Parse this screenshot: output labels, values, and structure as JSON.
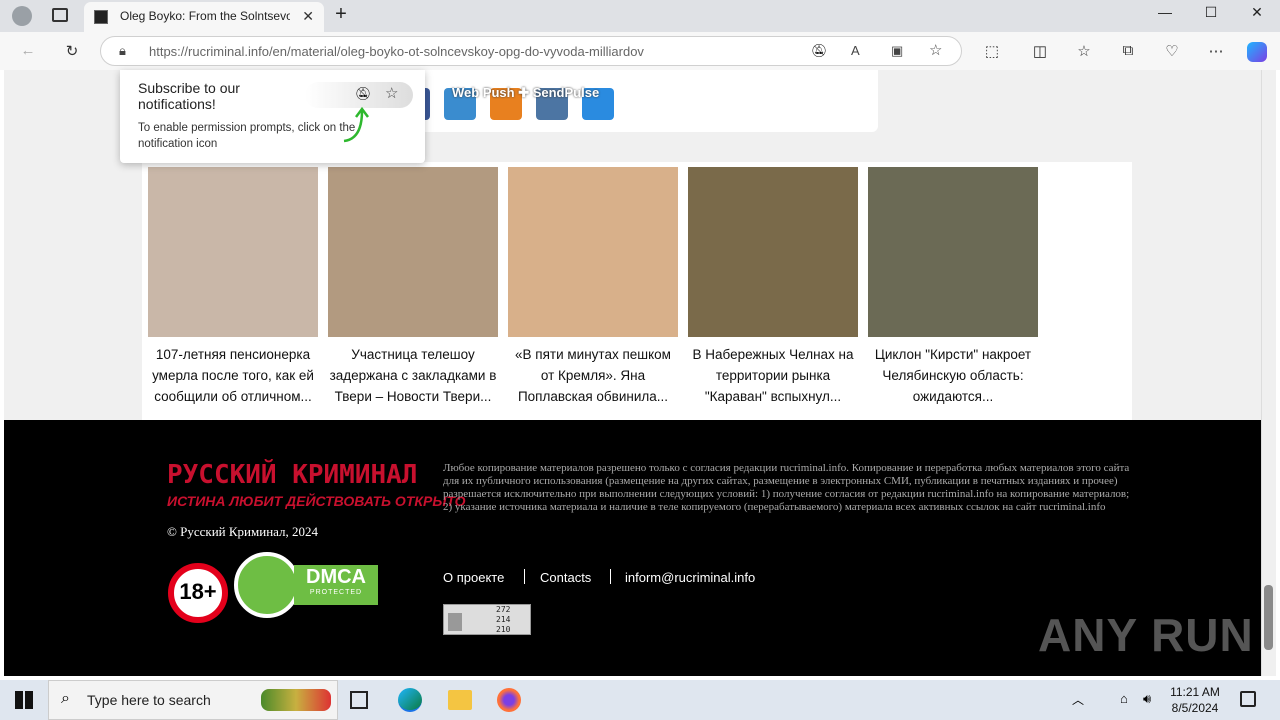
{
  "browser": {
    "tab_title": "Oleg Boyko: From the Solntsevo",
    "url_domain": "https://rucriminal.info",
    "url_path": "/en/material/oleg-boyko-ot-solncevskoy-opg-do-vyvoda-milliardov",
    "controls": {
      "min": "—",
      "max": "☐",
      "close": "✕",
      "new_tab": "+"
    }
  },
  "notification": {
    "heading": "Subscribe to our notifications!",
    "body": "To enable permission prompts, click on the notification icon"
  },
  "webpush": "Web Push ✚ SendPulse",
  "related": [
    {
      "caption": "107-летняя пенсионерка умерла после того, как ей сообщили об отличном...",
      "color": "#c9b7a8"
    },
    {
      "caption": "Участница телешоу задержана с закладками в Твери – Новости Твери...",
      "color": "#b29a80"
    },
    {
      "caption": "«В пяти минутах пешком от Кремля». Яна Поплавская обвинила...",
      "color": "#d8b08a"
    },
    {
      "caption": "В Набережных Челнах на территории рынка \"Караван\" вспыхнул...",
      "color": "#7a6a4a"
    },
    {
      "caption": "Циклон \"Кирсти\" накроет Челябинскую область: ожидаются...",
      "color": "#6b6a55"
    }
  ],
  "footer": {
    "logo_title": "РУССКИЙ КРИМИНАЛ",
    "logo_tagline": "ИСТИНА ЛЮБИТ ДЕЙСТВОВАТЬ ОТКРЫТО",
    "copyright": "© Русский Криминал, 2024",
    "legal": "Любое копирование материалов разрешено только с согласия редакции rucriminal.info. Копирование и переработка любых материалов этого сайта для их публичного использования (размещение на других сайтах, размещение в электронных СМИ, публикации в печатных изданиях и прочее) разрешается исключительно при выполнении следующих условий: 1) получение согласия от редакции rucriminal.info на копирование материалов; 2) указание источника материала и наличие в теле копируемого (перерабатываемого) материала всех активных ссылок на сайт rucriminal.info",
    "links": [
      "О проекте",
      "Contacts",
      "inform@rucriminal.info"
    ],
    "age": "18+",
    "dmca": "DMCA",
    "dmca_sub": "PROTECTED",
    "counter": [
      "272",
      "214",
      "210"
    ]
  },
  "watermark": "ANY RUN",
  "taskbar": {
    "search_placeholder": "Type here to search",
    "time": "11:21 AM",
    "date": "8/5/2024"
  }
}
